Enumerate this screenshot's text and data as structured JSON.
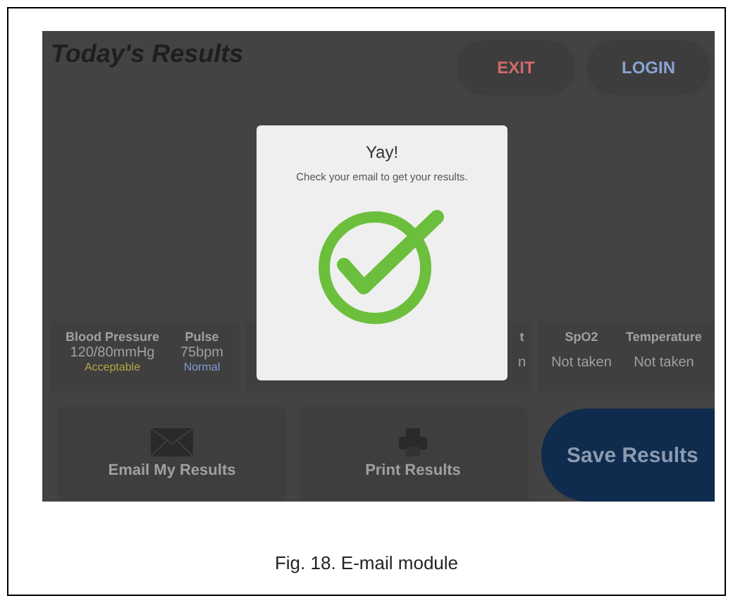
{
  "screen": {
    "title": "Today's Results",
    "header_buttons": [
      {
        "label": "EXIT",
        "kind": "exit"
      },
      {
        "label": "LOGIN",
        "kind": "login"
      }
    ],
    "vitals": [
      {
        "items": [
          {
            "label": "Blood Pressure",
            "value": "120/80mmHg",
            "status": "Acceptable",
            "color": "#b3a544"
          },
          {
            "label": "Pulse",
            "value": "75bpm",
            "status": "Normal",
            "color": "#7f9bd0"
          }
        ]
      },
      {
        "items": [
          {
            "label": "t",
            "value": "n"
          }
        ]
      },
      {
        "items": [
          {
            "label": "SpO2",
            "value": "Not taken"
          },
          {
            "label": "Temperature",
            "value": "Not taken"
          }
        ]
      }
    ],
    "actions": [
      {
        "label": "Email My Results",
        "kind": "email"
      },
      {
        "label": "Print Results",
        "kind": "print"
      },
      {
        "label": "Save Results",
        "kind": "save"
      }
    ],
    "dialog": {
      "title": "Yay!",
      "message": "Check your email to get your results."
    }
  },
  "figure": {
    "caption": "Fig. 18. E-mail module"
  }
}
